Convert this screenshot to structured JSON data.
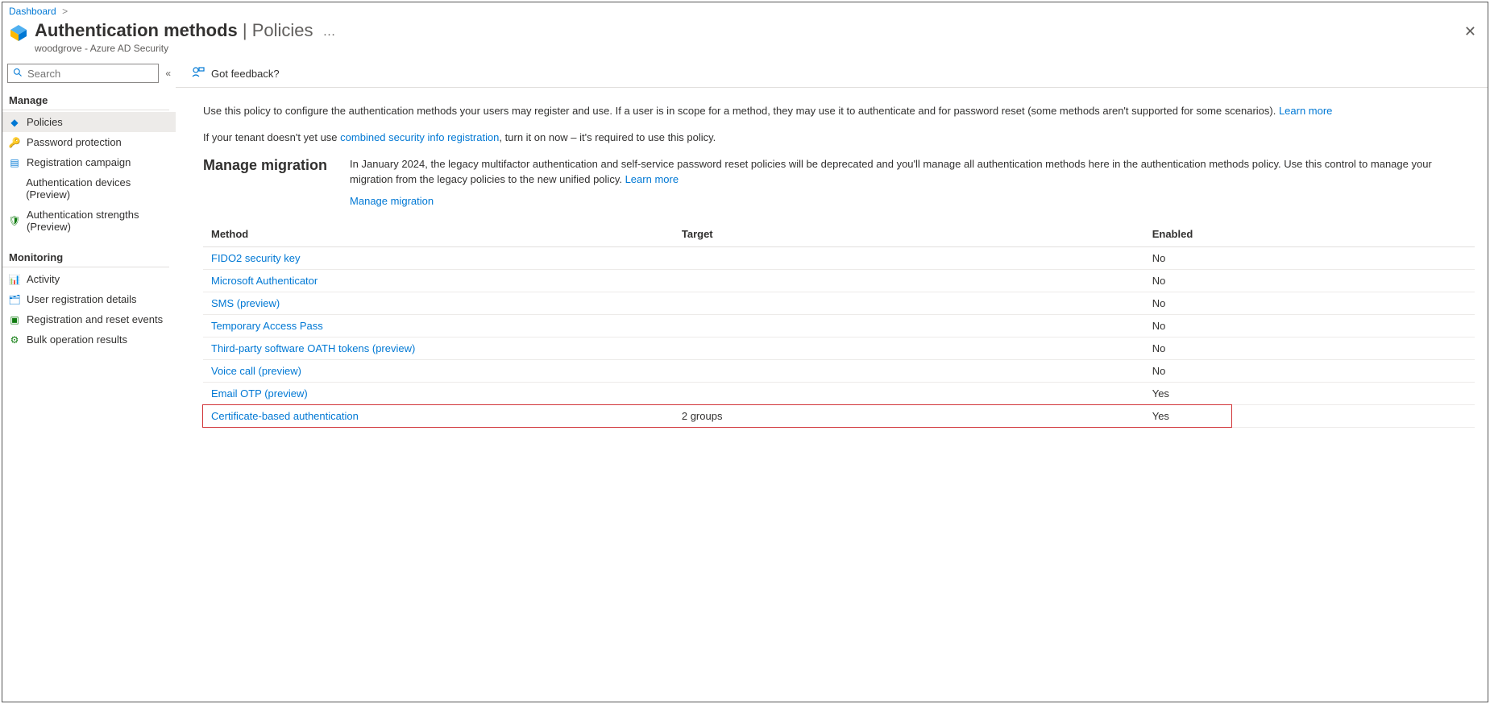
{
  "breadcrumb": {
    "root": "Dashboard"
  },
  "header": {
    "title_main": "Authentication methods",
    "title_sub": "Policies",
    "subtitle": "woodgrove - Azure AD Security",
    "more": "…"
  },
  "sidebar": {
    "search_placeholder": "Search",
    "sections": {
      "manage": {
        "title": "Manage",
        "items": [
          {
            "label": "Policies",
            "icon": "policies"
          },
          {
            "label": "Password protection",
            "icon": "key"
          },
          {
            "label": "Registration campaign",
            "icon": "campaign"
          },
          {
            "label": "Authentication devices (Preview)",
            "icon": ""
          },
          {
            "label": "Authentication strengths (Preview)",
            "icon": "shield"
          }
        ]
      },
      "monitoring": {
        "title": "Monitoring",
        "items": [
          {
            "label": "Activity",
            "icon": "chart"
          },
          {
            "label": "User registration details",
            "icon": "user"
          },
          {
            "label": "Registration and reset events",
            "icon": "events"
          },
          {
            "label": "Bulk operation results",
            "icon": "bulk"
          }
        ]
      }
    }
  },
  "toolbar": {
    "feedback": "Got feedback?"
  },
  "content": {
    "intro_pre": "Use this policy to configure the authentication methods your users may register and use. If a user is in scope for a method, they may use it to authenticate and for password reset (some methods aren't supported for some scenarios). ",
    "intro_link1": "Learn more",
    "tenant_pre": "If your tenant doesn't yet use ",
    "tenant_link": "combined security info registration",
    "tenant_post": ", turn it on now – it's required to use this policy.",
    "migration": {
      "heading": "Manage migration",
      "text_pre": "In January 2024, the legacy multifactor authentication and self-service password reset policies will be deprecated and you'll manage all authentication methods here in the authentication methods policy. Use this control to manage your migration from the legacy policies to the new unified policy. ",
      "text_link": "Learn more",
      "action": "Manage migration"
    },
    "table": {
      "headers": {
        "method": "Method",
        "target": "Target",
        "enabled": "Enabled"
      },
      "rows": [
        {
          "method": "FIDO2 security key",
          "target": "",
          "enabled": "No"
        },
        {
          "method": "Microsoft Authenticator",
          "target": "",
          "enabled": "No"
        },
        {
          "method": "SMS (preview)",
          "target": "",
          "enabled": "No"
        },
        {
          "method": "Temporary Access Pass",
          "target": "",
          "enabled": "No"
        },
        {
          "method": "Third-party software OATH tokens (preview)",
          "target": "",
          "enabled": "No"
        },
        {
          "method": "Voice call (preview)",
          "target": "",
          "enabled": "No"
        },
        {
          "method": "Email OTP (preview)",
          "target": "",
          "enabled": "Yes"
        },
        {
          "method": "Certificate-based authentication",
          "target": "2 groups",
          "enabled": "Yes"
        }
      ],
      "highlight_row_index": 7
    }
  }
}
